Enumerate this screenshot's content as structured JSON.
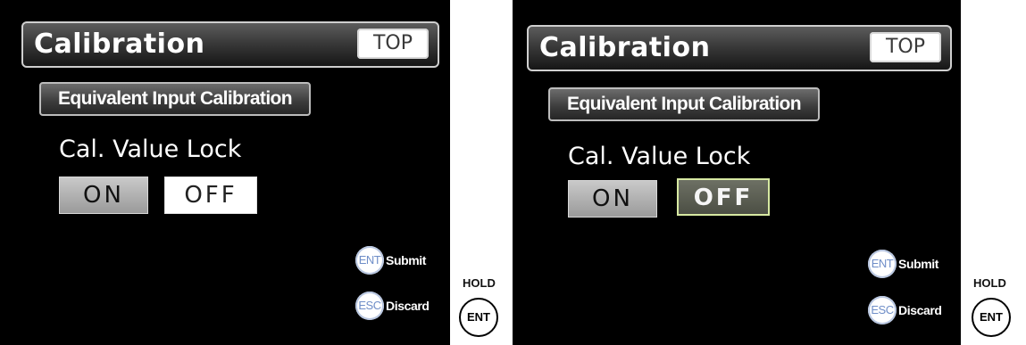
{
  "screens": [
    {
      "title": "Calibration",
      "top_button": "TOP",
      "section_tab": "Equivalent Input Calibration",
      "lock_label": "Cal. Value Lock",
      "on_label": "ON",
      "off_label": "OFF",
      "selected": "ON",
      "ent_icon": "ENT",
      "submit_label": "Submit",
      "esc_icon": "ESC",
      "discard_label": "Discard"
    },
    {
      "title": "Calibration",
      "top_button": "TOP",
      "section_tab": "Equivalent Input Calibration",
      "lock_label": "Cal. Value Lock",
      "on_label": "ON",
      "off_label": "OFF",
      "selected": "OFF",
      "ent_icon": "ENT",
      "submit_label": "Submit",
      "esc_icon": "ESC",
      "discard_label": "Discard"
    }
  ],
  "hardware_buttons": [
    {
      "hold_label": "HOLD",
      "key_label": "ENT"
    },
    {
      "hold_label": "HOLD",
      "key_label": "ENT"
    }
  ],
  "colors": {
    "screen_background": "#000000",
    "selected_off_border": "#d7e9a2",
    "soft_icon_text": "#6f8ec8"
  }
}
